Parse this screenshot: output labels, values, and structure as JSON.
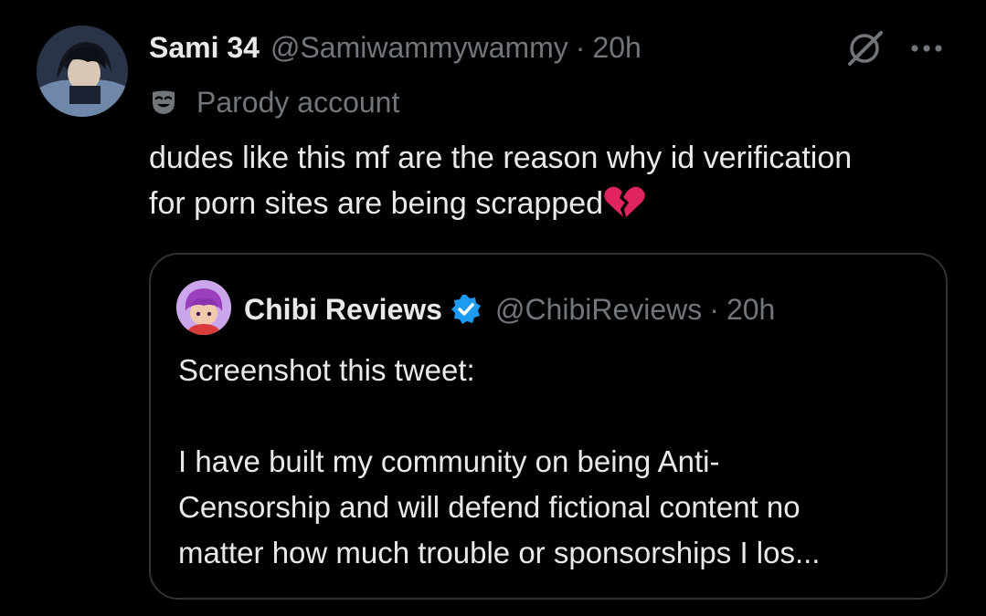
{
  "tweet": {
    "display_name": "Sami 34",
    "handle": "@Samiwammywammy",
    "separator": "·",
    "time": "20h",
    "badge_label": "Parody account",
    "text": "dudes like this mf are the reason why id verification\nfor porn sites are being scrapped",
    "emoji": "broken-heart"
  },
  "icons": {
    "grok": "grok-icon",
    "more": "more-icon",
    "parody": "parody-mask-icon",
    "verified": "verified-badge-icon"
  },
  "quote": {
    "display_name": "Chibi Reviews",
    "handle": "@ChibiReviews",
    "separator": "·",
    "time": "20h",
    "text": "Screenshot this tweet:\n\nI have built my community on being Anti-\nCensorship and will defend fictional content no\nmatter how much trouble or sponsorships I los..."
  },
  "colors": {
    "background": "#000000",
    "primary_text": "#e7e9ea",
    "secondary_text": "#71767b",
    "border": "#2f3336",
    "verified_blue": "#1d9bf0",
    "heart_red": "#f91880"
  }
}
